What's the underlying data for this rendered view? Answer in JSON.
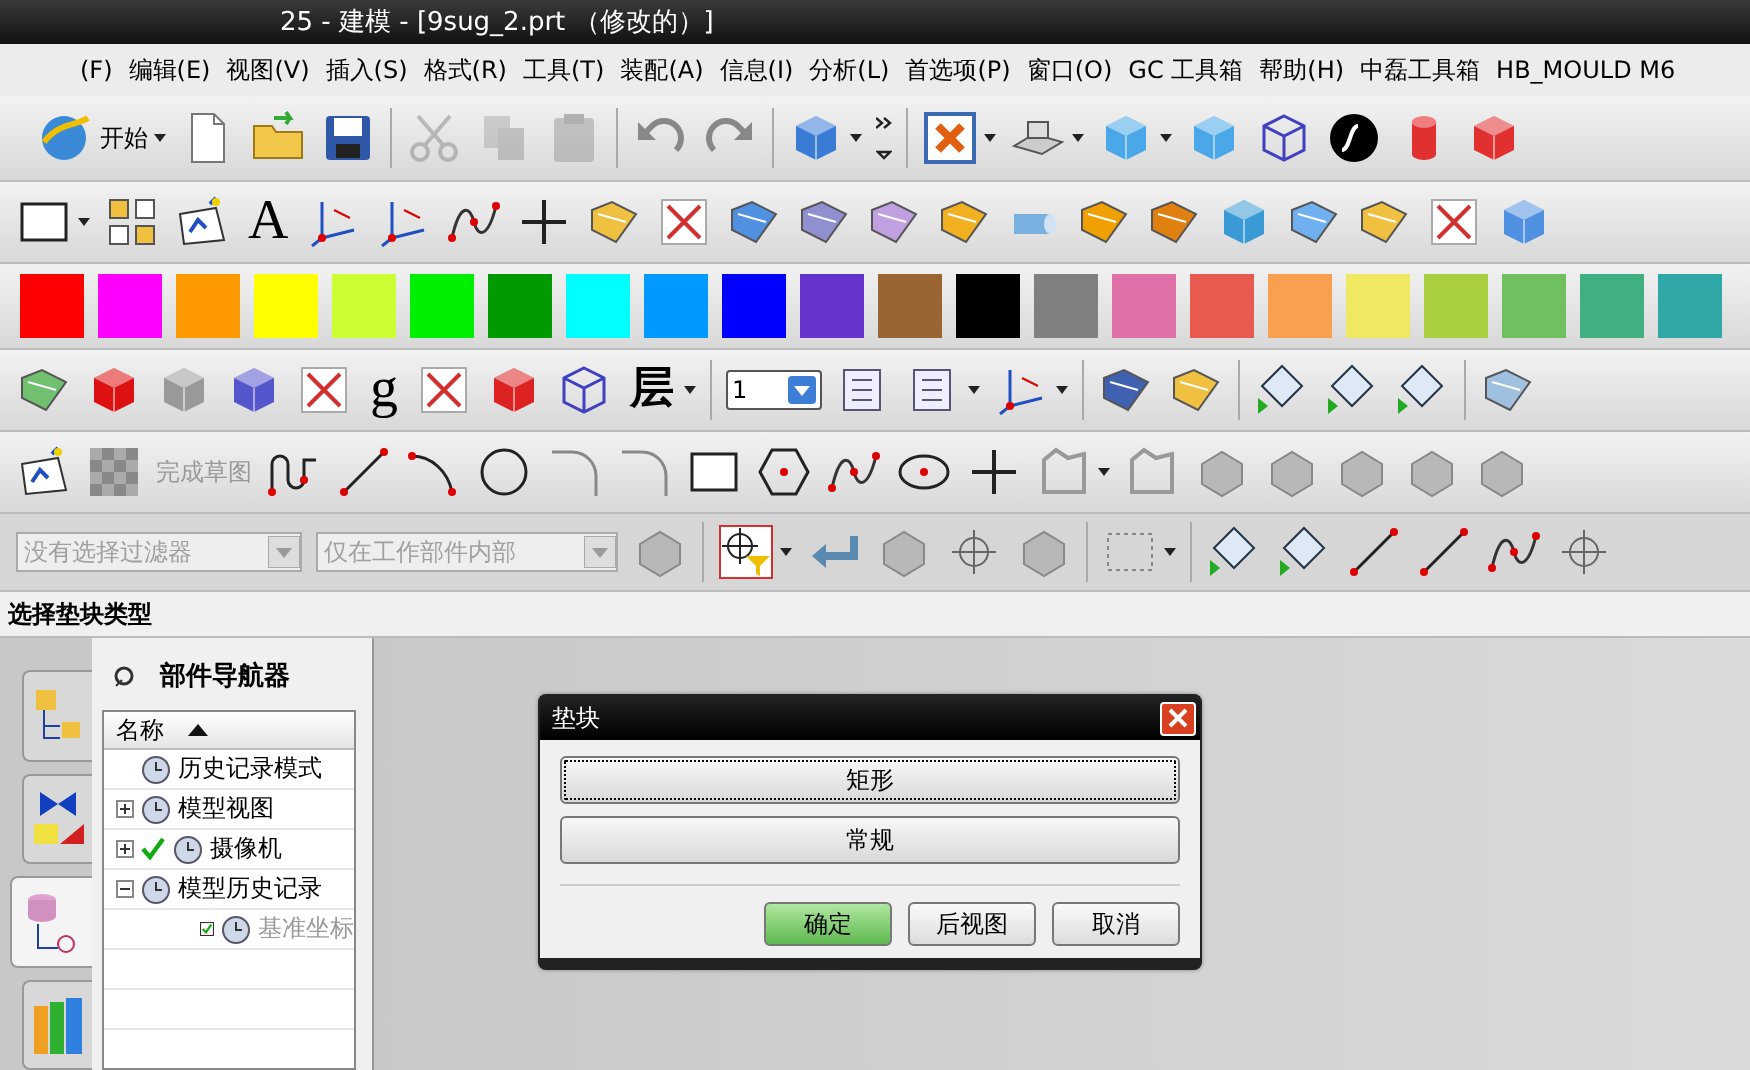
{
  "window": {
    "title": "25 - 建模 - [9sug_2.prt （修改的）]"
  },
  "menu": [
    "(F)",
    "编辑(E)",
    "视图(V)",
    "插入(S)",
    "格式(R)",
    "工具(T)",
    "装配(A)",
    "信息(I)",
    "分析(L)",
    "首选项(P)",
    "窗口(O)",
    "GC 工具箱",
    "帮助(H)",
    "中磊工具箱",
    "HB_MOULD M6"
  ],
  "toolbar": {
    "start_label": "开始",
    "text_tool_label": "A",
    "g_label": "g",
    "layer_label": "层",
    "layer_value": "1",
    "finish_sketch": {
      "label": "完成草图",
      "disabled": true
    },
    "edit_disabled": true
  },
  "palette": [
    {
      "color": "#ff0000"
    },
    {
      "color": "#ff00ff"
    },
    {
      "color": "#ff9900"
    },
    {
      "color": "#ffff00"
    },
    {
      "color": "#ccff33"
    },
    {
      "color": "#00ee00"
    },
    {
      "color": "#009900"
    },
    {
      "color": "#00ffff"
    },
    {
      "color": "#0099ff"
    },
    {
      "color": "#0000ff"
    },
    {
      "color": "#6633cc"
    },
    {
      "color": "#996633"
    },
    {
      "color": "#000000"
    },
    {
      "color": "#808080"
    },
    {
      "color": "#e070a8"
    },
    {
      "color": "#e85a50"
    },
    {
      "color": "#f8a050"
    },
    {
      "color": "#f0e860"
    },
    {
      "color": "#a8d040"
    },
    {
      "color": "#70c060"
    },
    {
      "color": "#40b080"
    },
    {
      "color": "#30a8a8"
    }
  ],
  "filters": [
    {
      "value": "没有选择过滤器",
      "disabled": true
    },
    {
      "value": "仅在工作部件内部",
      "disabled": true
    }
  ],
  "prompt": "选择垫块类型",
  "resource_tabs": [
    {
      "selected": false
    },
    {
      "selected": false
    },
    {
      "selected": true
    },
    {
      "selected": false
    }
  ],
  "navigator": {
    "title": "部件导航器",
    "column": "名称",
    "items": [
      {
        "label": "历史记录模式",
        "disabled": false
      },
      {
        "label": "模型视图",
        "expanded": false,
        "disabled": false
      },
      {
        "label": "摄像机",
        "expanded": false,
        "checked": true,
        "disabled": false
      },
      {
        "label": "模型历史记录",
        "expanded": true,
        "disabled": false,
        "children": [
          {
            "label": "基准坐标",
            "checked": true,
            "disabled": true
          }
        ]
      }
    ]
  },
  "dialog": {
    "title": "垫块",
    "options": [
      {
        "label": "矩形",
        "focused": true
      },
      {
        "label": "常规",
        "focused": false
      }
    ],
    "buttons": [
      {
        "label": "确定",
        "default": true
      },
      {
        "label": "后视图",
        "default": false
      },
      {
        "label": "取消",
        "default": false
      }
    ]
  }
}
